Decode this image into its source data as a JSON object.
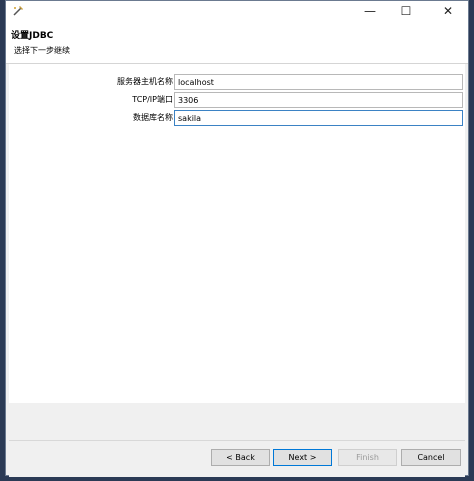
{
  "window": {
    "controls": {
      "minimize_icon": "—",
      "maximize_icon": "☐",
      "close_icon": "✕"
    }
  },
  "header": {
    "title": "设置JDBC",
    "subtitle": "选择下一步继续"
  },
  "form": {
    "fields": [
      {
        "label": "服务器主机名称",
        "value": "localhost"
      },
      {
        "label": "TCP/IP端口",
        "value": "3306"
      },
      {
        "label": "数据库名称",
        "value": "sakila"
      }
    ]
  },
  "buttons": {
    "back": "< Back",
    "next": "Next >",
    "finish": "Finish",
    "cancel": "Cancel"
  }
}
